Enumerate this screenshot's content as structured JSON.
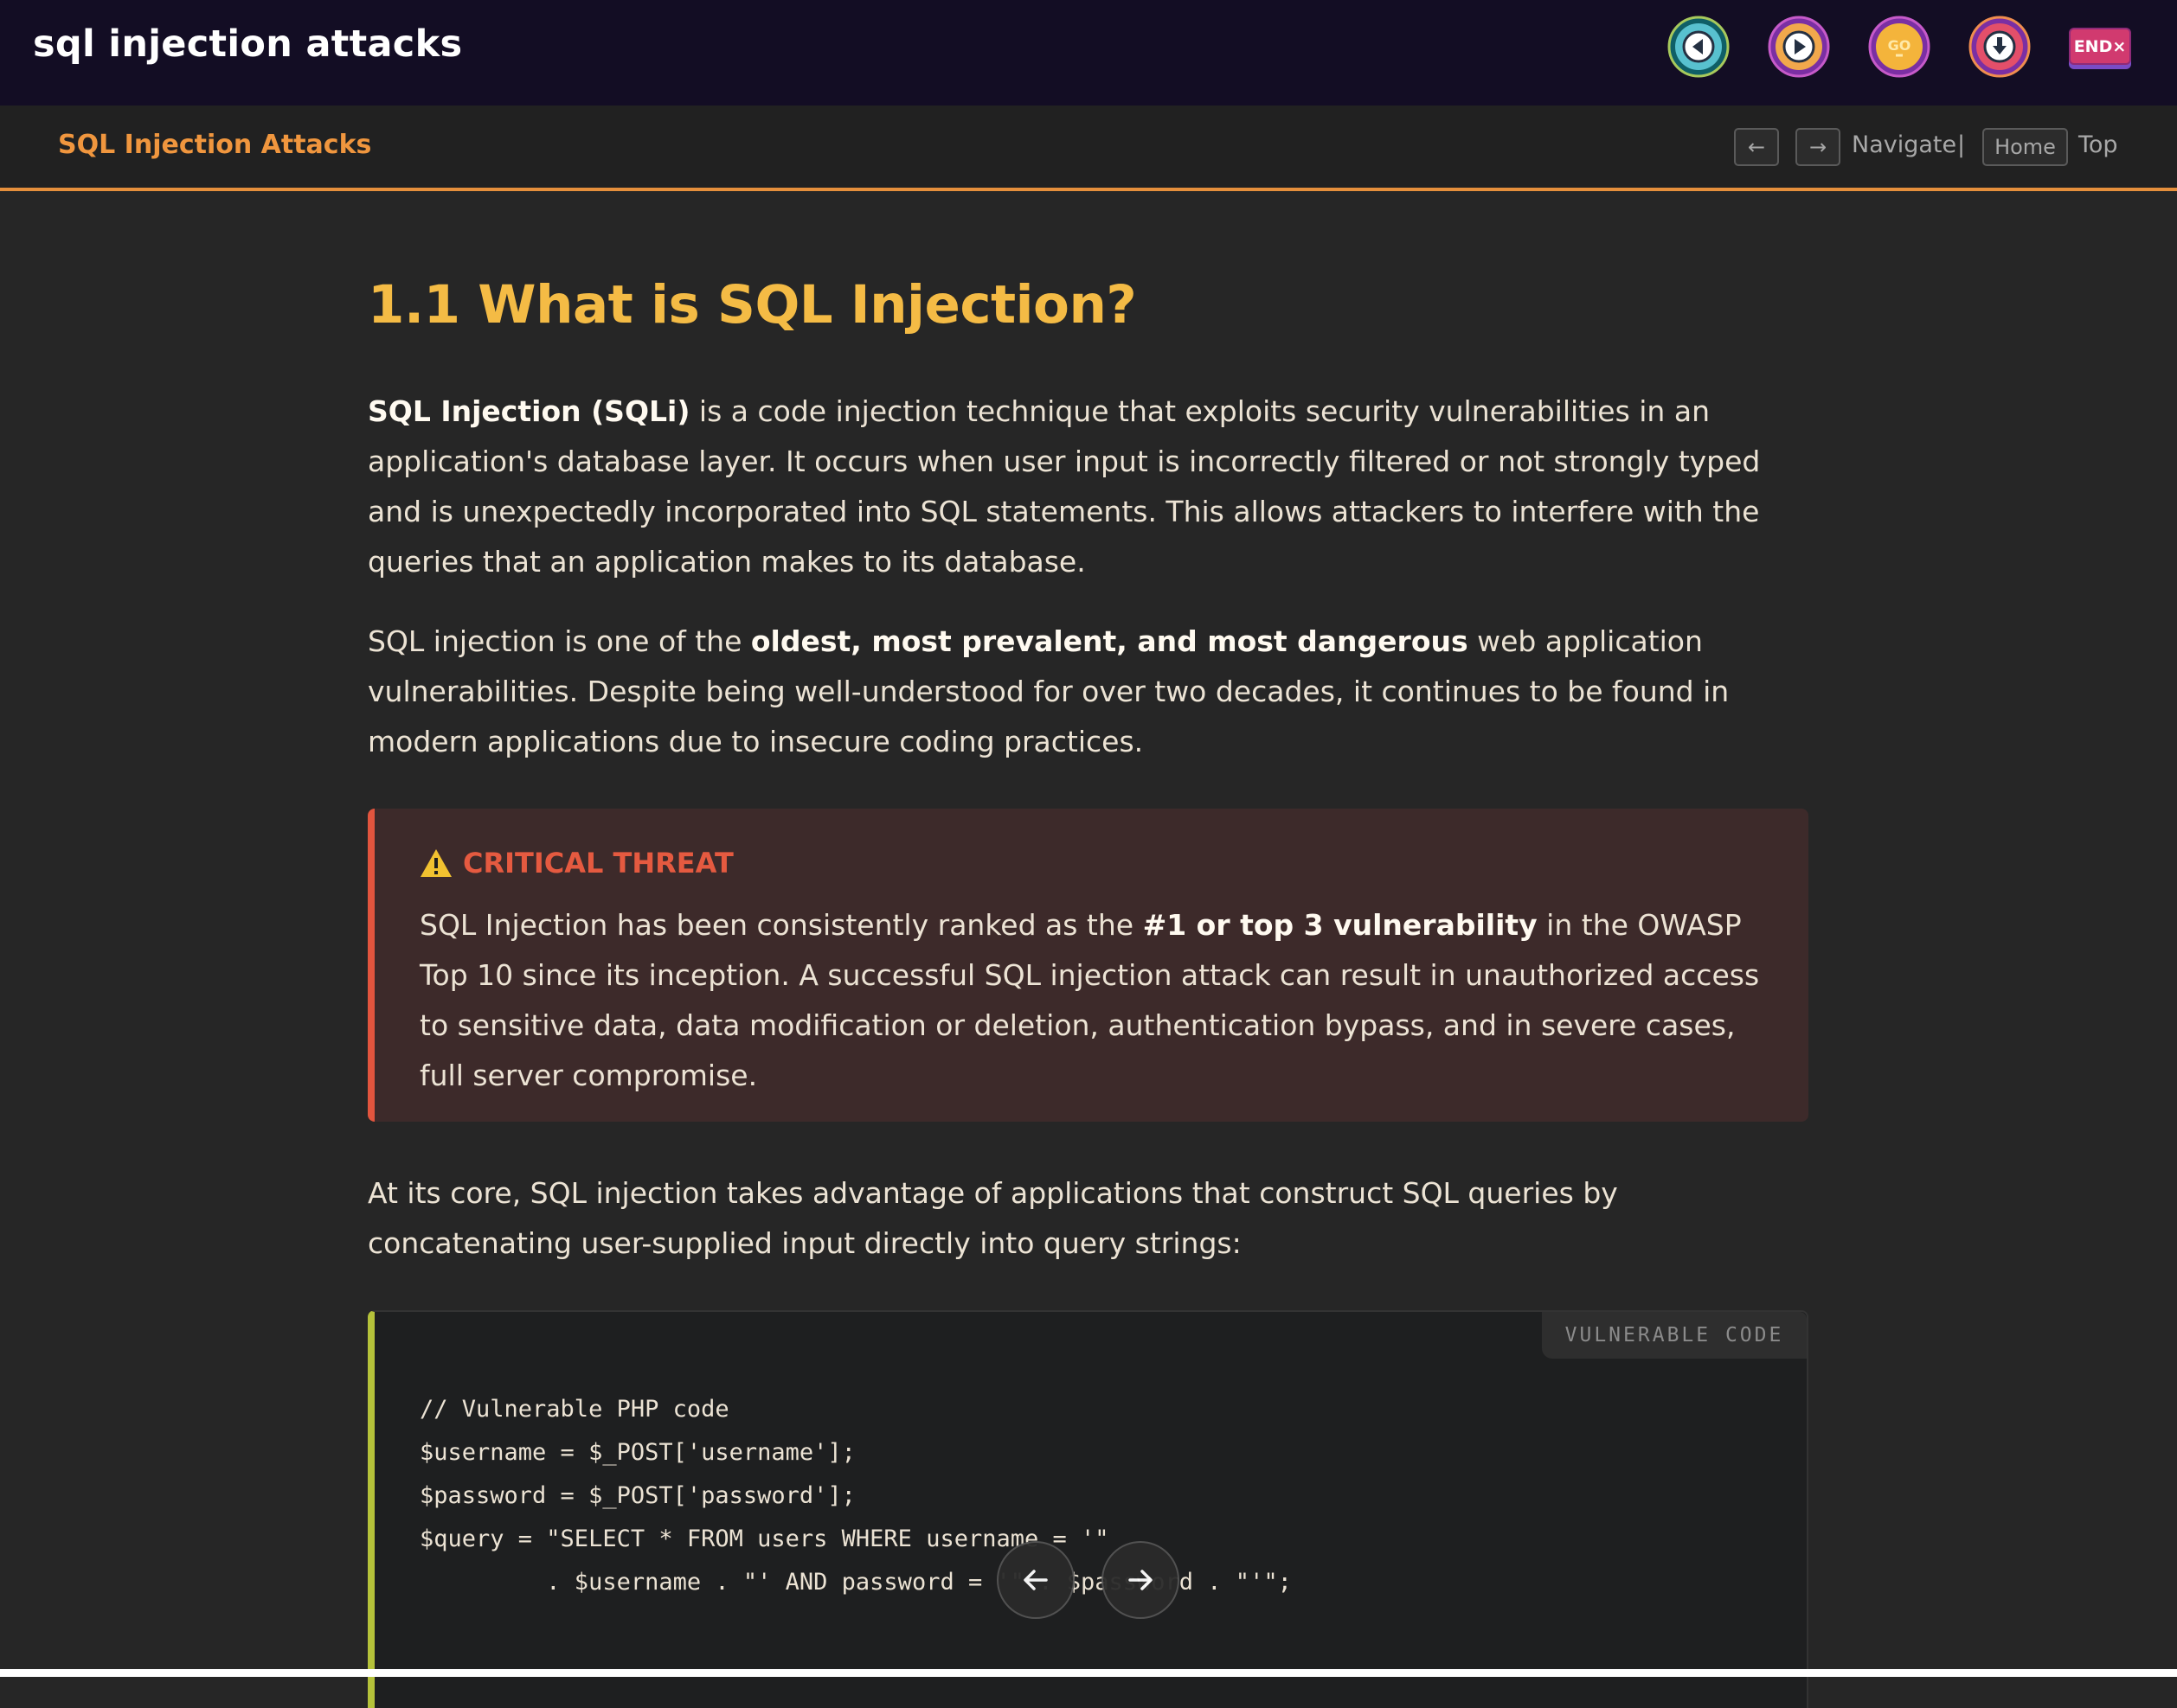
{
  "app": {
    "title": "sql injection attacks"
  },
  "controls": {
    "icons": [
      "rewind-icon",
      "play-icon",
      "go-icon",
      "download-icon"
    ],
    "end_label": "END",
    "end_mark": "×"
  },
  "subheader": {
    "title": "SQL Injection Attacks",
    "prev_key": "←",
    "next_key": "→",
    "navigate_label": "Navigate",
    "separator": "|",
    "home_key": "Home",
    "top_label": "Top"
  },
  "article": {
    "heading": "1.1 What is SQL Injection?",
    "p1": {
      "strong": "SQL Injection (SQLi)",
      "rest": " is a code injection technique that exploits security vulnerabilities in an application's database layer. It occurs when user input is incorrectly filtered or not strongly typed and is unexpectedly incorporated into SQL statements. This allows attackers to interfere with the queries that an application makes to its database."
    },
    "p2": {
      "before": "SQL injection is one of the ",
      "strong": "oldest, most prevalent, and most dangerous",
      "after": " web application vulnerabilities. Despite being well-understood for over two decades, it continues to be found in modern applications due to insecure coding practices."
    },
    "alert": {
      "title": "CRITICAL THREAT",
      "before": "SQL Injection has been consistently ranked as the ",
      "strong": "#1 or top 3 vulnerability",
      "after": " in the OWASP Top 10 since its inception. A successful SQL injection attack can result in unauthorized access to sensitive data, data modification or deletion, authentication bypass, and in severe cases, full server compromise."
    },
    "p3": "At its core, SQL injection takes advantage of applications that construct SQL queries by concatenating user-supplied input directly into query strings:",
    "code": {
      "label": "VULNERABLE CODE",
      "lines": [
        "// Vulnerable PHP code",
        "$username = $_POST['username'];",
        "$password = $_POST['password'];",
        "",
        "$query = \"SELECT * FROM users WHERE username = '\"",
        "         . $username . \"' AND password = '\" . $password . \"'\";"
      ]
    }
  },
  "pager": {
    "prev_icon": "arrow-left-icon",
    "next_icon": "arrow-right-icon"
  },
  "colors": {
    "accent": "#f0963e",
    "heading": "#f4bb45",
    "danger": "#e55a40",
    "code_border": "#b5c23a"
  }
}
